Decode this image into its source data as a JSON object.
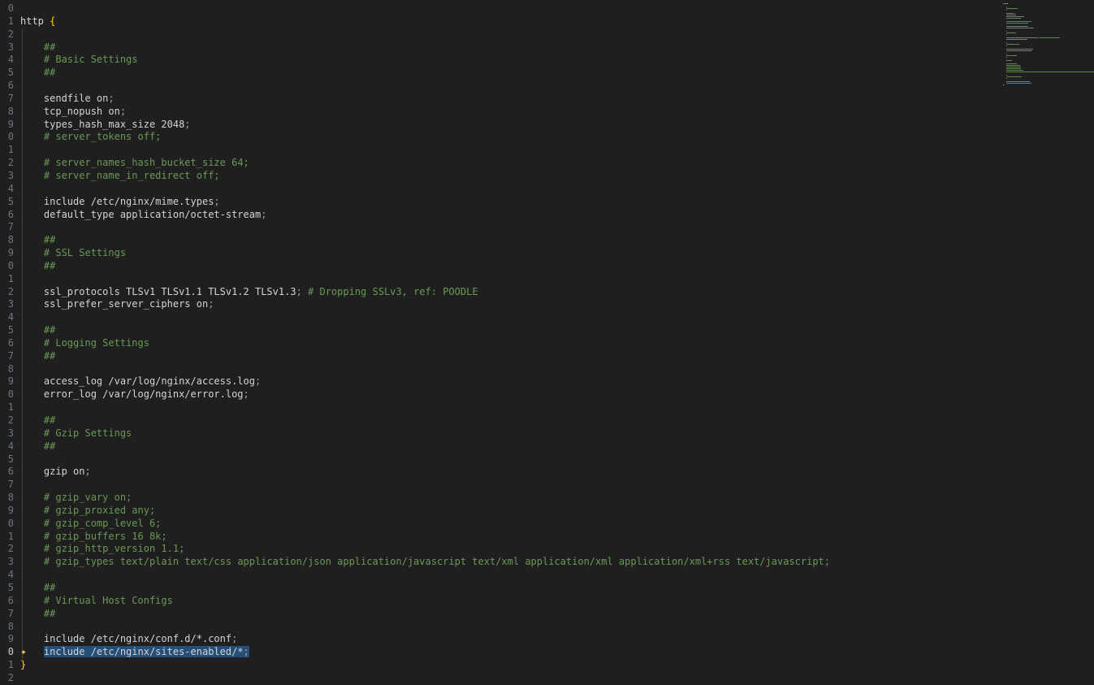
{
  "editor": {
    "language": "nginx",
    "gutter_start": 0,
    "active_line_index": 50,
    "selected_line_index": 50,
    "lines": [
      {
        "tokens": []
      },
      {
        "tokens": [
          {
            "t": "text",
            "v": "http "
          },
          {
            "t": "brace",
            "v": "{"
          }
        ]
      },
      {
        "tokens": []
      },
      {
        "tokens": [
          {
            "t": "text",
            "v": "    "
          },
          {
            "t": "comment",
            "v": "##"
          }
        ]
      },
      {
        "tokens": [
          {
            "t": "text",
            "v": "    "
          },
          {
            "t": "comment",
            "v": "# Basic Settings"
          }
        ]
      },
      {
        "tokens": [
          {
            "t": "text",
            "v": "    "
          },
          {
            "t": "comment",
            "v": "##"
          }
        ]
      },
      {
        "tokens": []
      },
      {
        "tokens": [
          {
            "t": "text",
            "v": "    sendfile on"
          },
          {
            "t": "semi",
            "v": ";"
          }
        ]
      },
      {
        "tokens": [
          {
            "t": "text",
            "v": "    tcp_nopush on"
          },
          {
            "t": "semi",
            "v": ";"
          }
        ]
      },
      {
        "tokens": [
          {
            "t": "text",
            "v": "    types_hash_max_size 2048"
          },
          {
            "t": "semi",
            "v": ";"
          }
        ]
      },
      {
        "tokens": [
          {
            "t": "text",
            "v": "    "
          },
          {
            "t": "comment",
            "v": "# server_tokens off;"
          }
        ]
      },
      {
        "tokens": []
      },
      {
        "tokens": [
          {
            "t": "text",
            "v": "    "
          },
          {
            "t": "comment",
            "v": "# server_names_hash_bucket_size 64;"
          }
        ]
      },
      {
        "tokens": [
          {
            "t": "text",
            "v": "    "
          },
          {
            "t": "comment",
            "v": "# server_name_in_redirect off;"
          }
        ]
      },
      {
        "tokens": []
      },
      {
        "tokens": [
          {
            "t": "text",
            "v": "    include /etc/nginx/mime.types"
          },
          {
            "t": "semi",
            "v": ";"
          }
        ]
      },
      {
        "tokens": [
          {
            "t": "text",
            "v": "    default_type application/octet-stream"
          },
          {
            "t": "semi",
            "v": ";"
          }
        ]
      },
      {
        "tokens": []
      },
      {
        "tokens": [
          {
            "t": "text",
            "v": "    "
          },
          {
            "t": "comment",
            "v": "##"
          }
        ]
      },
      {
        "tokens": [
          {
            "t": "text",
            "v": "    "
          },
          {
            "t": "comment",
            "v": "# SSL Settings"
          }
        ]
      },
      {
        "tokens": [
          {
            "t": "text",
            "v": "    "
          },
          {
            "t": "comment",
            "v": "##"
          }
        ]
      },
      {
        "tokens": []
      },
      {
        "tokens": [
          {
            "t": "text",
            "v": "    ssl_protocols TLSv1 TLSv1.1 TLSv1.2 TLSv1.3"
          },
          {
            "t": "semi",
            "v": ";"
          },
          {
            "t": "text",
            "v": " "
          },
          {
            "t": "comment",
            "v": "# Dropping SSLv3, ref: POODLE"
          }
        ]
      },
      {
        "tokens": [
          {
            "t": "text",
            "v": "    ssl_prefer_server_ciphers on"
          },
          {
            "t": "semi",
            "v": ";"
          }
        ]
      },
      {
        "tokens": []
      },
      {
        "tokens": [
          {
            "t": "text",
            "v": "    "
          },
          {
            "t": "comment",
            "v": "##"
          }
        ]
      },
      {
        "tokens": [
          {
            "t": "text",
            "v": "    "
          },
          {
            "t": "comment",
            "v": "# Logging Settings"
          }
        ]
      },
      {
        "tokens": [
          {
            "t": "text",
            "v": "    "
          },
          {
            "t": "comment",
            "v": "##"
          }
        ]
      },
      {
        "tokens": []
      },
      {
        "tokens": [
          {
            "t": "text",
            "v": "    access_log /var/log/nginx/access.log"
          },
          {
            "t": "semi",
            "v": ";"
          }
        ]
      },
      {
        "tokens": [
          {
            "t": "text",
            "v": "    error_log /var/log/nginx/error.log"
          },
          {
            "t": "semi",
            "v": ";"
          }
        ]
      },
      {
        "tokens": []
      },
      {
        "tokens": [
          {
            "t": "text",
            "v": "    "
          },
          {
            "t": "comment",
            "v": "##"
          }
        ]
      },
      {
        "tokens": [
          {
            "t": "text",
            "v": "    "
          },
          {
            "t": "comment",
            "v": "# Gzip Settings"
          }
        ]
      },
      {
        "tokens": [
          {
            "t": "text",
            "v": "    "
          },
          {
            "t": "comment",
            "v": "##"
          }
        ]
      },
      {
        "tokens": []
      },
      {
        "tokens": [
          {
            "t": "text",
            "v": "    gzip on"
          },
          {
            "t": "semi",
            "v": ";"
          }
        ]
      },
      {
        "tokens": []
      },
      {
        "tokens": [
          {
            "t": "text",
            "v": "    "
          },
          {
            "t": "comment",
            "v": "# gzip_vary on;"
          }
        ]
      },
      {
        "tokens": [
          {
            "t": "text",
            "v": "    "
          },
          {
            "t": "comment",
            "v": "# gzip_proxied any;"
          }
        ]
      },
      {
        "tokens": [
          {
            "t": "text",
            "v": "    "
          },
          {
            "t": "comment",
            "v": "# gzip_comp_level 6;"
          }
        ]
      },
      {
        "tokens": [
          {
            "t": "text",
            "v": "    "
          },
          {
            "t": "comment",
            "v": "# gzip_buffers 16 8k;"
          }
        ]
      },
      {
        "tokens": [
          {
            "t": "text",
            "v": "    "
          },
          {
            "t": "comment",
            "v": "# gzip_http_version 1.1;"
          }
        ]
      },
      {
        "tokens": [
          {
            "t": "text",
            "v": "    "
          },
          {
            "t": "comment",
            "v": "# gzip_types text/plain text/css application/json application/javascript text/xml application/xml application/xml+rss text/javascript;"
          }
        ]
      },
      {
        "tokens": []
      },
      {
        "tokens": [
          {
            "t": "text",
            "v": "    "
          },
          {
            "t": "comment",
            "v": "##"
          }
        ]
      },
      {
        "tokens": [
          {
            "t": "text",
            "v": "    "
          },
          {
            "t": "comment",
            "v": "# Virtual Host Configs"
          }
        ]
      },
      {
        "tokens": [
          {
            "t": "text",
            "v": "    "
          },
          {
            "t": "comment",
            "v": "##"
          }
        ]
      },
      {
        "tokens": []
      },
      {
        "tokens": [
          {
            "t": "text",
            "v": "    include /etc/nginx/conf.d/*.conf"
          },
          {
            "t": "semi",
            "v": ";"
          }
        ]
      },
      {
        "tokens": [
          {
            "t": "text",
            "v": "    include /etc/nginx/sites-enabled/*"
          },
          {
            "t": "semi",
            "v": ";"
          }
        ]
      },
      {
        "tokens": [
          {
            "t": "brace",
            "v": "}"
          }
        ]
      },
      {
        "tokens": []
      }
    ]
  },
  "icons": {
    "inline_chat": "sparkle-icon"
  },
  "colors": {
    "background": "#1f1f1f",
    "text": "#d4d4d4",
    "comment": "#6a9955",
    "brace": "#ffd700",
    "semicolon": "#9d9d9d",
    "selection": "#264f78",
    "line_number": "#6e7681",
    "sparkle": "#f0c43a"
  }
}
